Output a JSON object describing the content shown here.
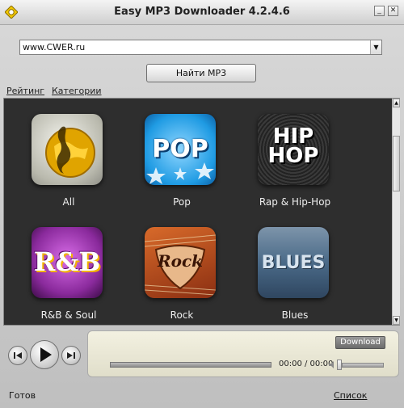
{
  "window": {
    "title": "Easy MP3 Downloader  4.2.4.6",
    "minimize_glyph": "_",
    "close_glyph": "✕"
  },
  "search": {
    "url_value": "www.CWER.ru",
    "find_button": "Найти MP3"
  },
  "links": {
    "rating": "Рейтинг",
    "categories": "Категории"
  },
  "categories": [
    {
      "label": "All",
      "icon": "globe-treble-clef-icon"
    },
    {
      "label": "Pop",
      "icon": "pop-icon",
      "icon_text": "POP"
    },
    {
      "label": "Rap & Hip-Hop",
      "icon": "hip-hop-icon",
      "icon_text": "HIP HOP"
    },
    {
      "label": "R&B & Soul",
      "icon": "rnb-icon",
      "icon_text": "R&B"
    },
    {
      "label": "Rock",
      "icon": "rock-guitar-icon",
      "icon_text": "Rock"
    },
    {
      "label": "Blues",
      "icon": "blues-icon",
      "icon_text": "BLUES"
    }
  ],
  "player": {
    "download_label": "Download",
    "time": "00:00 / 00:00",
    "progress": 0,
    "volume": 0.0
  },
  "status": {
    "text": "Готов",
    "list_link": "Список"
  },
  "colors": {
    "panel_bg": "#2e2e2e",
    "player_bg": "#efedda",
    "pop_blue": "#1f9be3",
    "rnb_purple": "#8a2a9c",
    "rock_red": "#b5471c",
    "blues_steel": "#4a6a88"
  }
}
